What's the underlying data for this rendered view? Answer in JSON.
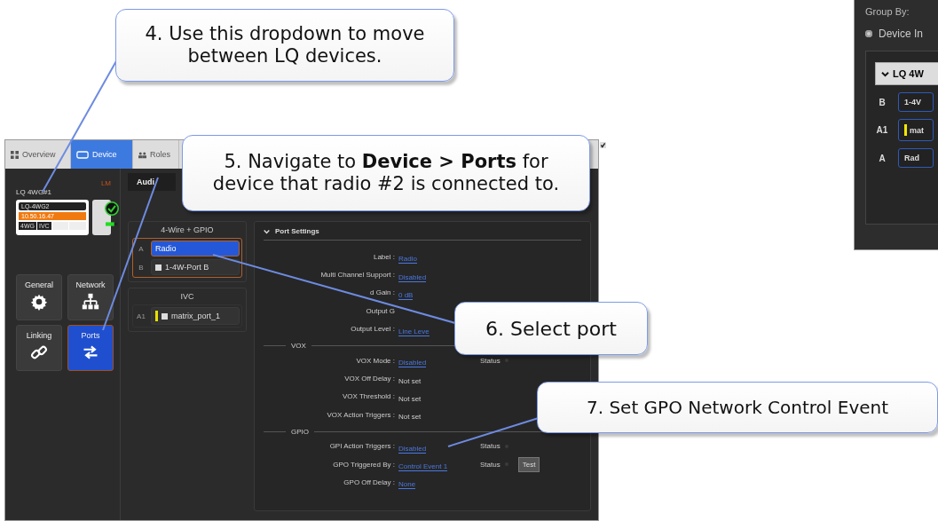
{
  "tabs": [
    {
      "label": "Overview",
      "selected": false
    },
    {
      "label": "Device",
      "selected": true
    },
    {
      "label": "Roles",
      "selected": false
    }
  ],
  "device": {
    "name": "LQ 4WG#1",
    "badge": "LM",
    "card_title": "LQ-4WG2",
    "ip": "10.50.16.47",
    "tags": [
      "4WG",
      "IVC"
    ]
  },
  "nav_tiles": [
    {
      "label": "General",
      "selected": false
    },
    {
      "label": "Network",
      "selected": false
    },
    {
      "label": "Linking",
      "selected": false
    },
    {
      "label": "Ports",
      "selected": true
    }
  ],
  "subtab": "Audi",
  "port_groups": [
    {
      "title": "4-Wire + GPIO",
      "highlighted": true,
      "ports": [
        {
          "id": "A",
          "label": "Radio",
          "checked": true,
          "selected": true
        },
        {
          "id": "B",
          "label": "1-4W-Port B",
          "checked": false,
          "selected": false
        }
      ]
    },
    {
      "title": "IVC",
      "highlighted": false,
      "ports": [
        {
          "id": "A1",
          "label": "matrix_port_1",
          "checked": false,
          "selected": false,
          "color": "#e8e000"
        }
      ]
    }
  ],
  "port_settings": {
    "title": "Port Settings",
    "sections": [
      {
        "rows": [
          {
            "label": "Label :",
            "value": "Radio",
            "kind": "link"
          },
          {
            "label": "Multi Channel Support :",
            "value": "Disabled",
            "kind": "link"
          },
          {
            "label": "d Gain :",
            "value": "0 dB",
            "kind": "link"
          },
          {
            "label": "Output G"
          },
          {
            "label": "Output Level :",
            "value": "Line Leve",
            "kind": "link"
          }
        ]
      },
      {
        "title": "VOX",
        "rows": [
          {
            "label": "VOX Mode :",
            "value": "Disabled",
            "kind": "link",
            "status": "Status"
          },
          {
            "label": "VOX Off Delay :",
            "value": "Not set",
            "kind": "text"
          },
          {
            "label": "VOX Threshold :",
            "value": "Not set",
            "kind": "text"
          },
          {
            "label": "VOX Action Triggers :",
            "value": "Not set",
            "kind": "text"
          }
        ]
      },
      {
        "title": "GPIO",
        "rows": [
          {
            "label": "GPI Action Triggers :",
            "value": "Disabled",
            "kind": "link",
            "status": "Status"
          },
          {
            "label": "GPO Triggered By :",
            "value": "Control Event 1",
            "kind": "link",
            "status": "Status",
            "button": "Test"
          },
          {
            "label": "GPO Off Delay :",
            "value": "None",
            "kind": "link"
          }
        ]
      }
    ]
  },
  "inset": {
    "group_by": "Group By:",
    "radio": {
      "label": "Device In",
      "selected": true
    },
    "dropdown": "LQ 4W",
    "ports": [
      {
        "id": "B",
        "label": "1-4V"
      },
      {
        "id": "A1",
        "label": "mat",
        "color": "#f0e800"
      },
      {
        "id": "A",
        "label": "Rad"
      }
    ]
  },
  "callouts": [
    {
      "text": "4. Use this dropdown to move between LQ  devices."
    },
    {
      "text": "5. Navigate to **Device > Ports** for device that radio #2 is connected to."
    },
    {
      "text": "6. Select port"
    },
    {
      "text": "7. Set GPO Network Control Event"
    }
  ]
}
